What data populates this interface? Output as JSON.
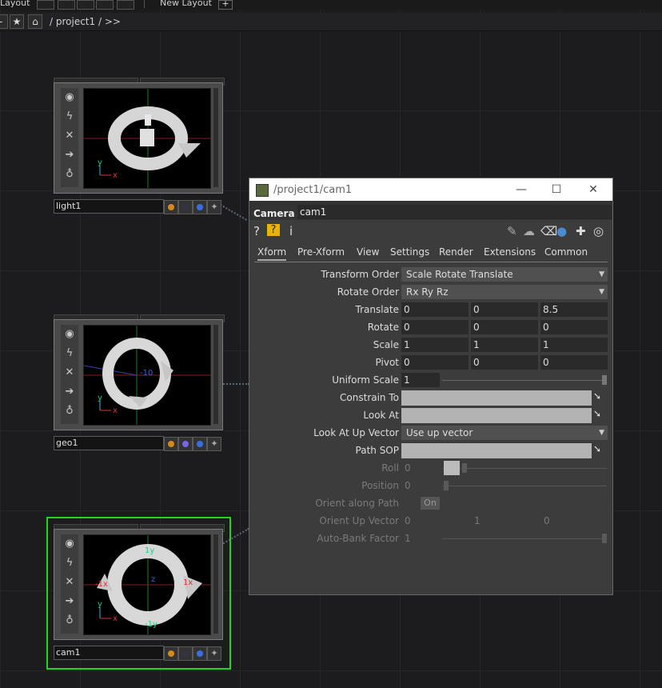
{
  "layout_bar": {
    "label": "Layout",
    "new_layout": "New Layout",
    "add": "+"
  },
  "path_bar": {
    "path": "/ project1 / >>"
  },
  "nodes": [
    {
      "name": "light1",
      "flags": [
        "#d4891a",
        "#333344",
        "#3a6ee0"
      ]
    },
    {
      "name": "geo1",
      "flags": [
        "#d4891a",
        "#7b63e6",
        "#3a6ee0"
      ]
    },
    {
      "name": "cam1",
      "flags": [
        "#d4891a",
        "#333344",
        "#3a6ee0"
      ],
      "selected": true
    }
  ],
  "viewport_labels": {
    "light1": {
      "y": "y",
      "x": "x"
    },
    "geo1": {
      "y": "y",
      "x": "x",
      "mark": "-10"
    },
    "cam1": {
      "top": "1y",
      "left": "-1x",
      "right": "1x",
      "bottom": "-1y",
      "z": "z",
      "y": "y",
      "x": "x"
    }
  },
  "dialog": {
    "title": "/project1/cam1",
    "op_type": "Camera",
    "op_name": "cam1",
    "tabs": [
      "Xform",
      "Pre-Xform",
      "View",
      "Settings",
      "Render",
      "Extensions",
      "Common"
    ],
    "active_tab": "Xform",
    "params": {
      "transform_order": {
        "label": "Transform Order",
        "value": "Scale Rotate Translate"
      },
      "rotate_order": {
        "label": "Rotate Order",
        "value": "Rx Ry Rz"
      },
      "translate": {
        "label": "Translate",
        "values": [
          "0",
          "0",
          "8.5"
        ]
      },
      "rotate": {
        "label": "Rotate",
        "values": [
          "0",
          "0",
          "0"
        ]
      },
      "scale": {
        "label": "Scale",
        "values": [
          "1",
          "1",
          "1"
        ]
      },
      "pivot": {
        "label": "Pivot",
        "values": [
          "0",
          "0",
          "0"
        ]
      },
      "uniform_scale": {
        "label": "Uniform Scale",
        "value": "1"
      },
      "constrain_to": {
        "label": "Constrain To"
      },
      "look_at": {
        "label": "Look At"
      },
      "look_at_up": {
        "label": "Look At Up Vector",
        "value": "Use up vector"
      },
      "path_sop": {
        "label": "Path SOP"
      },
      "roll": {
        "label": "Roll",
        "value": "0"
      },
      "position": {
        "label": "Position",
        "value": "0"
      },
      "orient_path": {
        "label": "Orient along Path",
        "value": "On"
      },
      "orient_up": {
        "label": "Orient Up Vector",
        "values": [
          "0",
          "1",
          "0"
        ]
      },
      "auto_bank": {
        "label": "Auto-Bank Factor",
        "value": "1"
      }
    }
  }
}
